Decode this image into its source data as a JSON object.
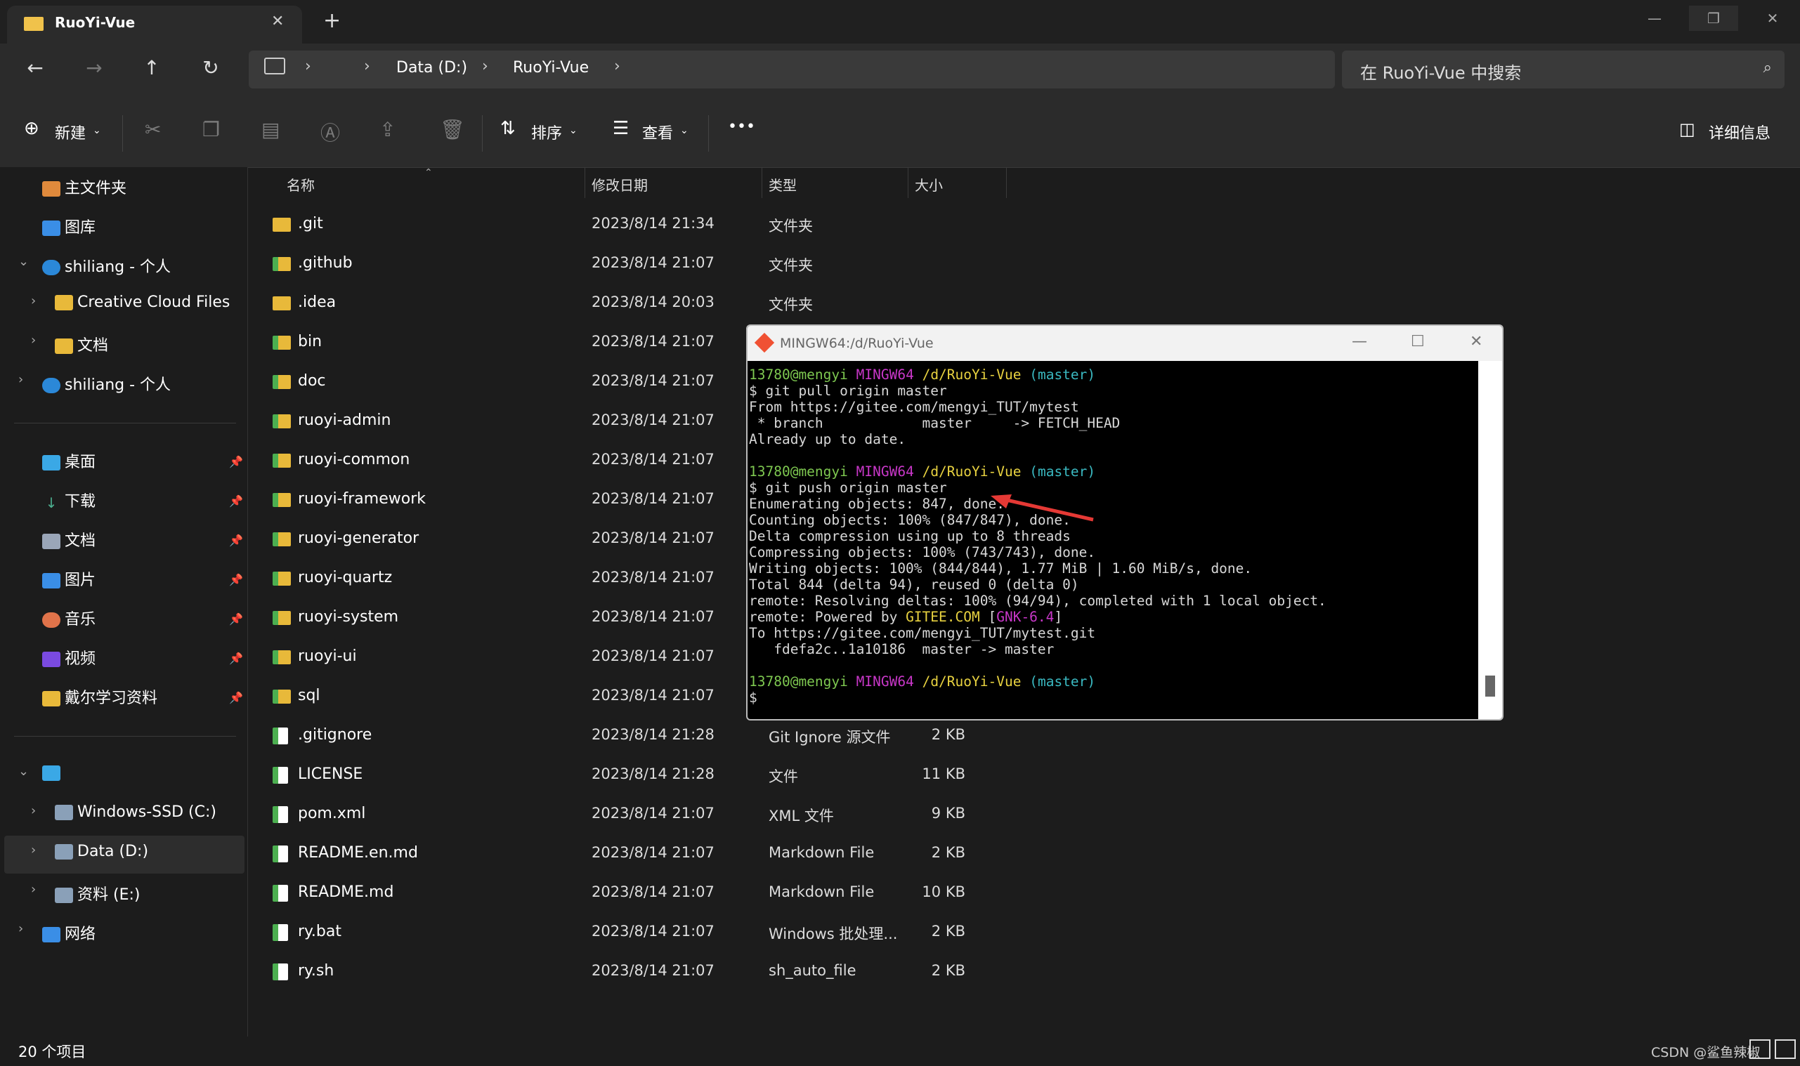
{
  "window": {
    "tab_title": "RuoYi-Vue",
    "close_tab": "✕",
    "new_tab": "+",
    "minimize": "—",
    "maximize": "❐",
    "close": "✕"
  },
  "nav": {
    "back": "←",
    "forward": "→",
    "up": "↑",
    "refresh": "↻",
    "breadcrumb": [
      "Data (D:)",
      "RuoYi-Vue"
    ],
    "search_placeholder": "在 RuoYi-Vue 中搜索"
  },
  "toolbar": {
    "new_label": "新建",
    "sort_label": "排序",
    "view_label": "查看",
    "more_label": "•••",
    "details_label": "详细信息"
  },
  "sidebar": {
    "items": [
      {
        "label": "主文件夹",
        "icon": "home-icon"
      },
      {
        "label": "图库",
        "icon": "gallery-icon"
      },
      {
        "label": "shiliang - 个人",
        "icon": "cloud-icon"
      },
      {
        "label": "Creative Cloud Files",
        "icon": "folder-icon"
      },
      {
        "label": "文档",
        "icon": "folder-icon"
      },
      {
        "label": "shiliang - 个人",
        "icon": "cloud-icon"
      },
      {
        "label": "桌面",
        "icon": "desktop-icon"
      },
      {
        "label": "下载",
        "icon": "download-icon"
      },
      {
        "label": "文档",
        "icon": "document-icon"
      },
      {
        "label": "图片",
        "icon": "pictures-icon"
      },
      {
        "label": "音乐",
        "icon": "music-icon"
      },
      {
        "label": "视频",
        "icon": "video-icon"
      },
      {
        "label": "戴尔学习资料",
        "icon": "folder-icon"
      },
      {
        "label": "Windows-SSD (C:)",
        "icon": "drive-icon"
      },
      {
        "label": "Data (D:)",
        "icon": "drive-icon"
      },
      {
        "label": "资料 (E:)",
        "icon": "drive-icon"
      },
      {
        "label": "网络",
        "icon": "network-icon"
      }
    ]
  },
  "columns": {
    "name": "名称",
    "modified": "修改日期",
    "type": "类型",
    "size": "大小"
  },
  "files": [
    {
      "name": ".git",
      "date": "2023/8/14 21:34",
      "type": "文件夹",
      "size": ""
    },
    {
      "name": ".github",
      "date": "2023/8/14 21:07",
      "type": "文件夹",
      "size": ""
    },
    {
      "name": ".idea",
      "date": "2023/8/14 20:03",
      "type": "文件夹",
      "size": ""
    },
    {
      "name": "bin",
      "date": "2023/8/14 21:07",
      "type": "",
      "size": ""
    },
    {
      "name": "doc",
      "date": "2023/8/14 21:07",
      "type": "",
      "size": ""
    },
    {
      "name": "ruoyi-admin",
      "date": "2023/8/14 21:07",
      "type": "",
      "size": ""
    },
    {
      "name": "ruoyi-common",
      "date": "2023/8/14 21:07",
      "type": "",
      "size": ""
    },
    {
      "name": "ruoyi-framework",
      "date": "2023/8/14 21:07",
      "type": "",
      "size": ""
    },
    {
      "name": "ruoyi-generator",
      "date": "2023/8/14 21:07",
      "type": "",
      "size": ""
    },
    {
      "name": "ruoyi-quartz",
      "date": "2023/8/14 21:07",
      "type": "",
      "size": ""
    },
    {
      "name": "ruoyi-system",
      "date": "2023/8/14 21:07",
      "type": "",
      "size": ""
    },
    {
      "name": "ruoyi-ui",
      "date": "2023/8/14 21:07",
      "type": "",
      "size": ""
    },
    {
      "name": "sql",
      "date": "2023/8/14 21:07",
      "type": "",
      "size": ""
    },
    {
      "name": ".gitignore",
      "date": "2023/8/14 21:28",
      "type": "Git Ignore 源文件",
      "size": "2 KB"
    },
    {
      "name": "LICENSE",
      "date": "2023/8/14 21:28",
      "type": "文件",
      "size": "11 KB"
    },
    {
      "name": "pom.xml",
      "date": "2023/8/14 21:07",
      "type": "XML 文件",
      "size": "9 KB"
    },
    {
      "name": "README.en.md",
      "date": "2023/8/14 21:07",
      "type": "Markdown File",
      "size": "2 KB"
    },
    {
      "name": "README.md",
      "date": "2023/8/14 21:07",
      "type": "Markdown File",
      "size": "10 KB"
    },
    {
      "name": "ry.bat",
      "date": "2023/8/14 21:07",
      "type": "Windows 批处理...",
      "size": "2 KB"
    },
    {
      "name": "ry.sh",
      "date": "2023/8/14 21:07",
      "type": "sh_auto_file",
      "size": "2 KB"
    }
  ],
  "status": {
    "count": "20 个项目",
    "watermark": "CSDN @鲨鱼辣椒"
  },
  "terminal": {
    "title": "MINGW64:/d/RuoYi-Vue",
    "prompt_user": "13780@mengyi",
    "prompt_sys": "MINGW64",
    "prompt_path": "/d/RuoYi-Vue",
    "prompt_branch": "(master)",
    "cmd1": "$ git pull origin master",
    "out1": [
      "From https://gitee.com/mengyi_TUT/mytest",
      " * branch            master     -> FETCH_HEAD",
      "Already up to date."
    ],
    "cmd2": "$ git push origin master",
    "out2": [
      "Enumerating objects: 847, done.",
      "Counting objects: 100% (847/847), done.",
      "Delta compression using up to 8 threads",
      "Compressing objects: 100% (743/743), done.",
      "Writing objects: 100% (844/844), 1.77 MiB | 1.60 MiB/s, done.",
      "Total 844 (delta 94), reused 0 (delta 0)",
      "remote: Resolving deltas: 100% (94/94), completed with 1 local object."
    ],
    "powered_prefix": "remote: Powered by ",
    "powered_gitee": "GITEE.COM",
    "powered_ver_open": " [",
    "powered_ver": "GNK-6.4",
    "powered_ver_close": "]",
    "out3": [
      "To https://gitee.com/mengyi_TUT/mytest.git",
      "   fdefa2c..1a10186  master -> master"
    ],
    "cmd3": "$"
  },
  "colors": {
    "accent_arrow": "#e53935",
    "folder": "#e8b93a",
    "term_green": "#7ec850",
    "term_magenta": "#c837c8",
    "term_yellow": "#e8d240",
    "term_cyan": "#3ab8c0"
  }
}
